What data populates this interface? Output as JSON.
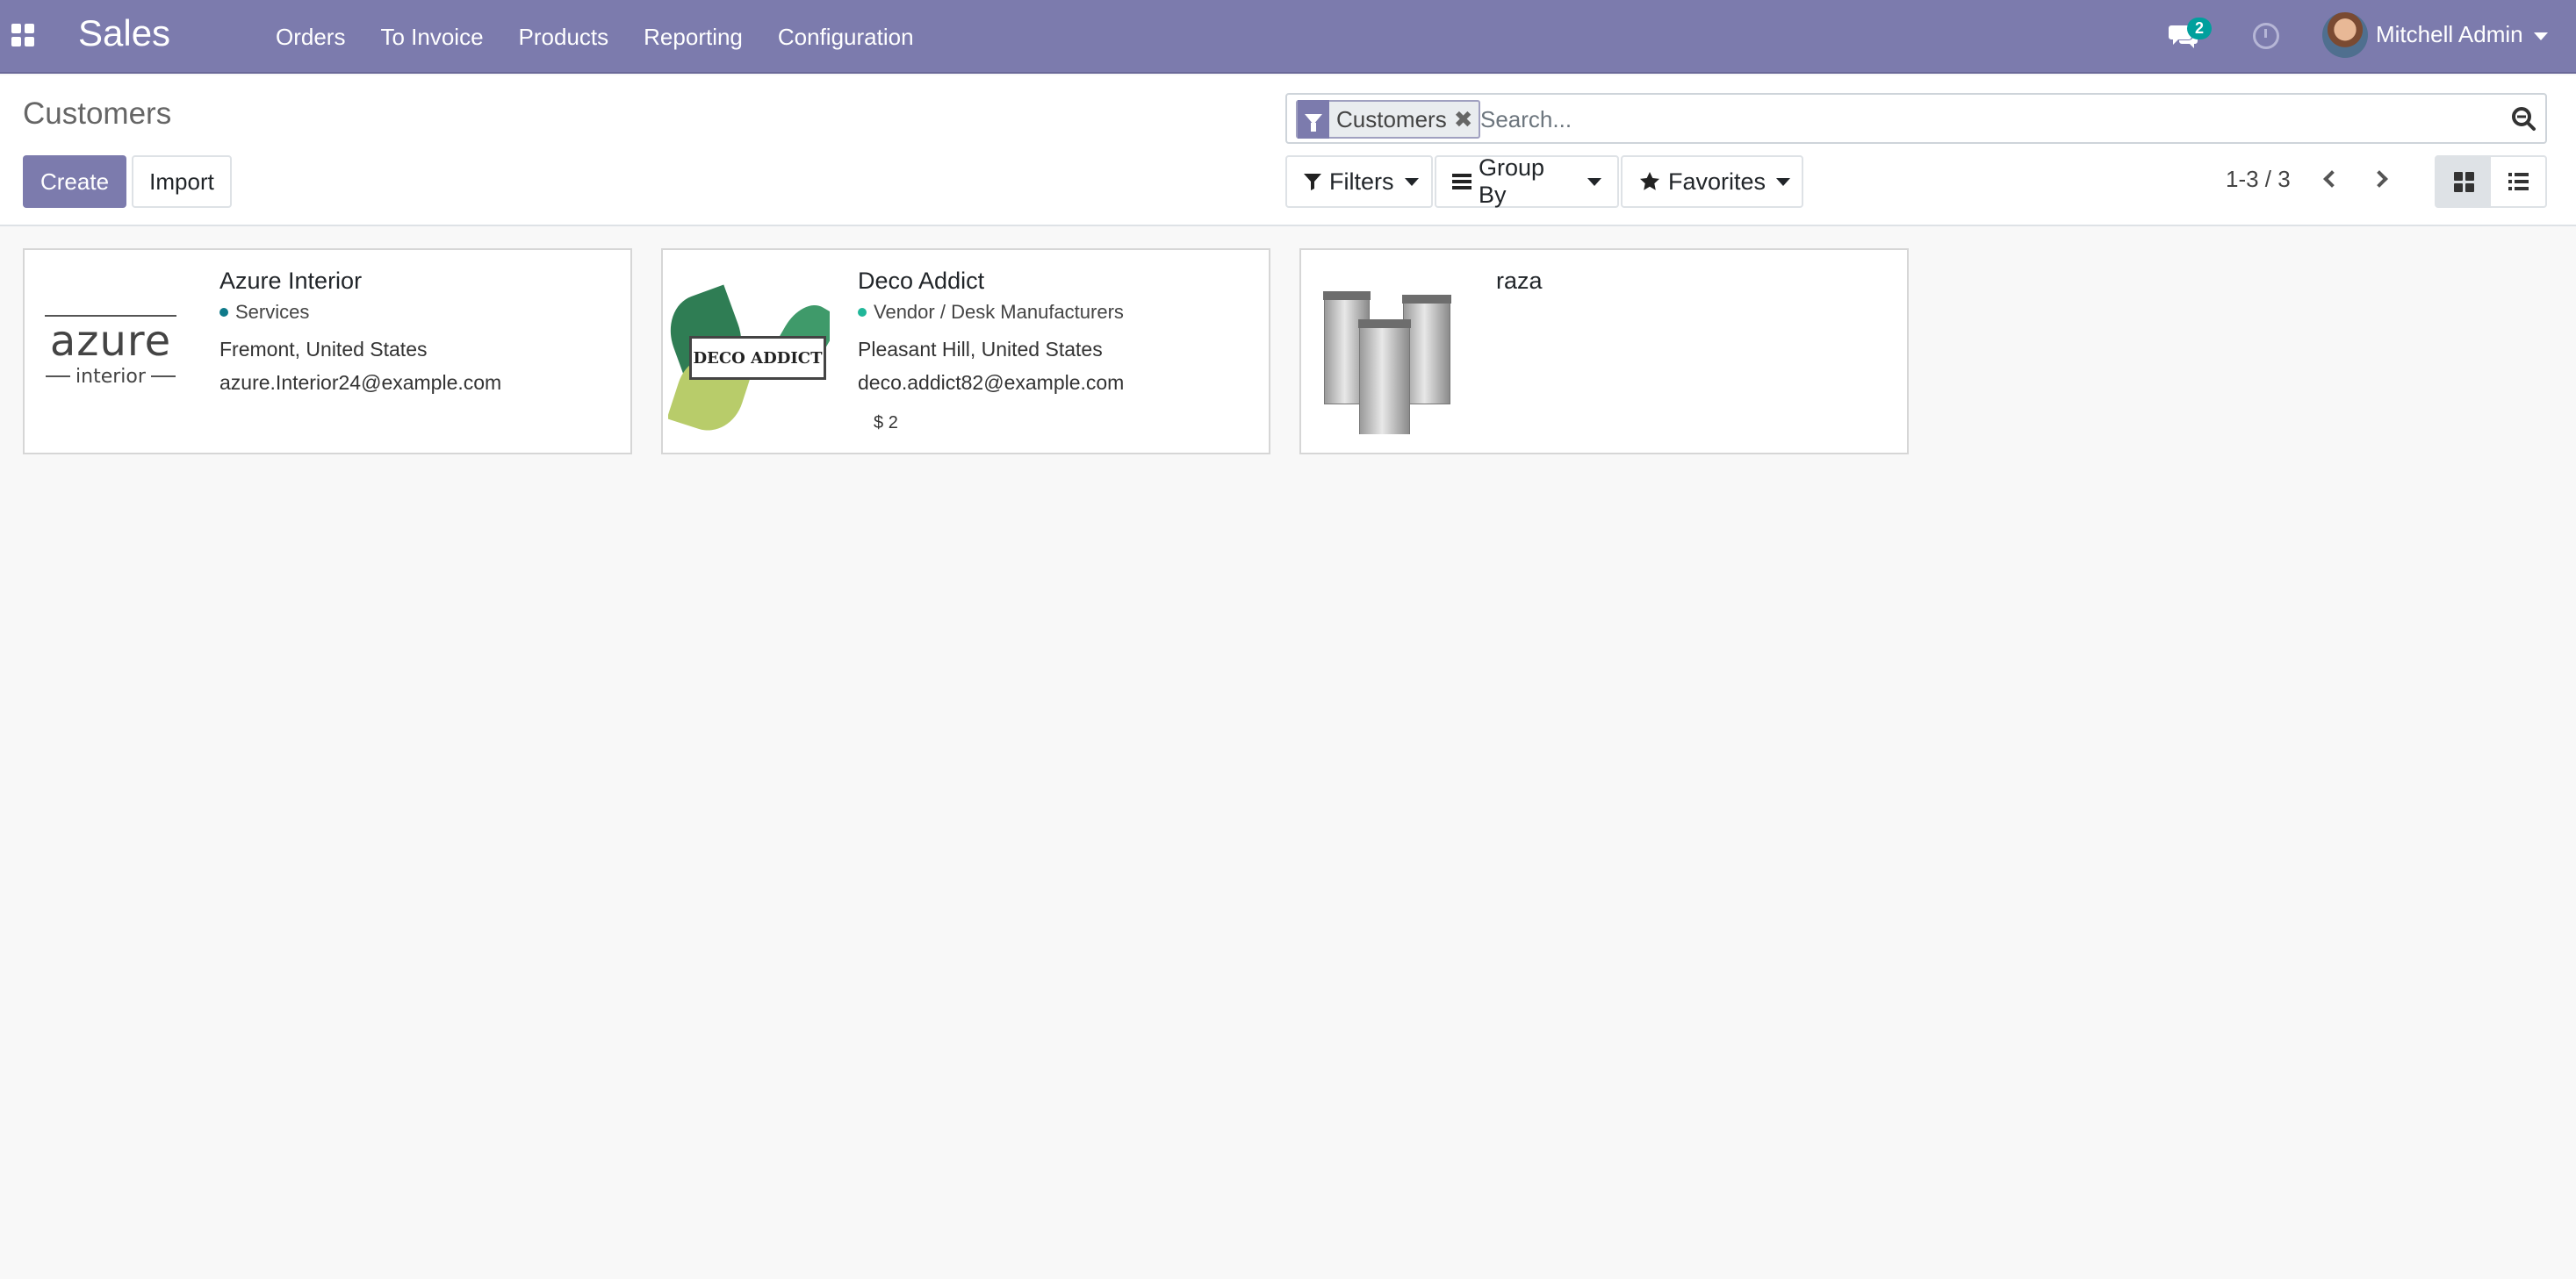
{
  "navbar": {
    "app_title": "Sales",
    "menu": [
      "Orders",
      "To Invoice",
      "Products",
      "Reporting",
      "Configuration"
    ],
    "messages_badge": "2",
    "user_name": "Mitchell Admin",
    "color": "#7c7bad"
  },
  "control_panel": {
    "breadcrumb": "Customers",
    "create_label": "Create",
    "import_label": "Import",
    "search": {
      "facet_label": "Customers",
      "placeholder": "Search..."
    },
    "filters_label": "Filters",
    "groupby_label": "Group By",
    "favorites_label": "Favorites",
    "pager": "1-3 / 3"
  },
  "cards": [
    {
      "name": "Azure Interior",
      "tag": "Services",
      "tag_color": "#0f7a8a",
      "location": "Fremont, United States",
      "email": "azure.Interior24@example.com",
      "logo_text": "azure",
      "logo_sub": "interior"
    },
    {
      "name": "Deco Addict",
      "tag": "Vendor / Desk Manufacturers",
      "tag_color": "#21b799",
      "location": "Pleasant Hill, United States",
      "email": "deco.addict82@example.com",
      "sales_count": "2",
      "logo_text": "DECO ADDICT"
    },
    {
      "name": "raza"
    }
  ]
}
